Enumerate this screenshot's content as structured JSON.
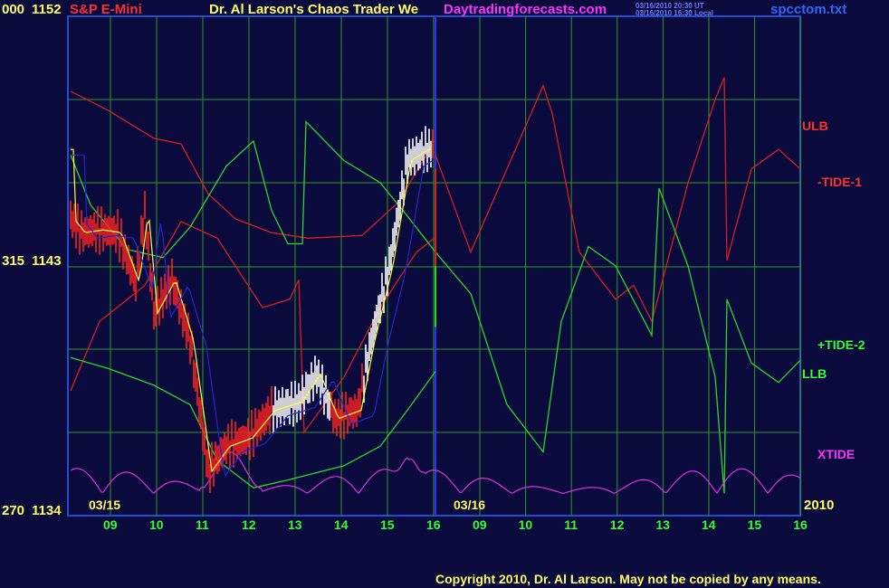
{
  "header": {
    "left_value": "000",
    "top_price": "1152",
    "symbol": "S&P E-Mini",
    "title": "Dr. Al Larson's Chaos Trader We",
    "website": "Daytradingforecasts.com",
    "timestamp_ut": "03/16/2010 20:30 UT",
    "timestamp_local": "03/16/2010 16:30 Local",
    "filename": "spcctom.txt"
  },
  "yaxis": {
    "mid_left": "315",
    "mid_price": "1143",
    "bottom_left": "270",
    "bottom_price": "1134"
  },
  "date_labels": {
    "day1": "03/15",
    "day2": "03/16",
    "year": "2010"
  },
  "hour_labels": [
    "09",
    "10",
    "11",
    "12",
    "13",
    "14",
    "15",
    "16",
    "09",
    "10",
    "11",
    "12",
    "13",
    "14",
    "15",
    "16"
  ],
  "series_labels": {
    "ulb": "ULB",
    "tide1": "-TIDE-1",
    "tide2": "+TIDE-2",
    "llb": "LLB",
    "xtide": "XTIDE"
  },
  "footer": {
    "copyright": "Copyright 2010, Dr. Al Larson. May not be copied by any means."
  },
  "colors": {
    "background": "#0a0a3c",
    "grid": "#2a9a2a",
    "ulb": "#d62020",
    "tide1": "#d62020",
    "tide2": "#2ad82a",
    "llb": "#2ad82a",
    "xtide": "#e030e0",
    "price": "#ffffff",
    "ma": "#ffff40",
    "ma2": "#2424d0"
  },
  "chart_data": {
    "type": "line",
    "title": "S&P E-Mini",
    "ylim": [
      1134,
      1152
    ],
    "y_ticks": [
      1134,
      1143,
      1152
    ],
    "x_labels": [
      "09",
      "10",
      "11",
      "12",
      "13",
      "14",
      "15",
      "16",
      "09",
      "10",
      "11",
      "12",
      "13",
      "14",
      "15",
      "16"
    ],
    "series": [
      {
        "name": "ULB",
        "values": [
          1149.3,
          1147.9,
          1145.5,
          1143.7,
          1144.5,
          1145.2,
          1148.5,
          1148.5,
          1146.2,
          1146.8
        ]
      },
      {
        "name": "-TIDE-1",
        "values": [
          1146.5,
          1145.2,
          1143.3,
          1140.5,
          1138.0,
          1136.5,
          1141.0,
          1148.0,
          1143.0,
          1147.0
        ]
      },
      {
        "name": "+TIDE-2",
        "values": [
          1148.0,
          1142.0,
          1143.5,
          1147.0,
          1146.0,
          1140.0,
          1138.5,
          1146.5,
          1141.5,
          1139.5
        ]
      },
      {
        "name": "LLB",
        "values": [
          1141.0,
          1140.0,
          1136.0,
          1135.0,
          1135.5,
          1136.5,
          1139.0,
          1137.5,
          1142.0,
          1138.0
        ]
      },
      {
        "name": "XTIDE",
        "values": [
          1136.0,
          1134.5,
          1137.5,
          1134.5,
          1135.5,
          1137.0,
          1134.0,
          1135.5,
          1136.0,
          1136.5
        ]
      }
    ]
  }
}
